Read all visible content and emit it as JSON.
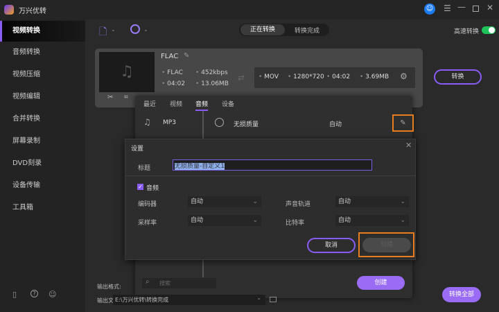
{
  "app": {
    "title": "万兴优转"
  },
  "sidebar": {
    "items": [
      {
        "label": "视频转换"
      },
      {
        "label": "音频转换"
      },
      {
        "label": "视频压缩"
      },
      {
        "label": "视频编辑"
      },
      {
        "label": "合并转换"
      },
      {
        "label": "屏幕录制"
      },
      {
        "label": "DVD刻录"
      },
      {
        "label": "设备传输"
      },
      {
        "label": "工具箱"
      }
    ]
  },
  "toolbar": {
    "tabs": [
      {
        "label": "正在转换",
        "active": true
      },
      {
        "label": "转换完成"
      }
    ],
    "fast_convert_label": "高速转换",
    "fast_convert_on": true
  },
  "file": {
    "name": "FLAC",
    "src_format": "FLAC",
    "src_bitrate": "452kbps",
    "src_duration": "04:02",
    "src_size": "13.06MB",
    "out_format": "MOV",
    "out_resolution": "1280*720",
    "out_duration": "04:02",
    "out_size": "3.69MB",
    "convert_label": "转换"
  },
  "format_panel": {
    "tabs": [
      "最近",
      "视频",
      "音频",
      "设备"
    ],
    "active_tab": "音频",
    "left_item": "MP3",
    "preset_name": "无损质量",
    "preset_value": "自动",
    "search_placeholder": "搜索",
    "create_label": "创建"
  },
  "dialog": {
    "title": "设置",
    "title_label": "标题",
    "title_value": "无损质量-自定义1",
    "audio_label": "音频",
    "audio_checked": true,
    "fields": [
      {
        "label": "编码器",
        "value": "自动"
      },
      {
        "label": "声音轨道",
        "value": "自动"
      },
      {
        "label": "采样率",
        "value": "自动"
      },
      {
        "label": "比特率",
        "value": "自动"
      }
    ],
    "cancel_label": "取消",
    "create_label": "创建"
  },
  "footer": {
    "output_format_label": "输出格式:",
    "output_folder_label": "输出文件夹:",
    "output_folder_value": "E:\\万兴优转\\转换完成",
    "convert_all_label": "转换全部"
  },
  "colors": {
    "accent": "#8a5cf6",
    "highlight": "#e87c1e",
    "toggle": "#1ec35a",
    "avatar": "#1e7cf2"
  }
}
